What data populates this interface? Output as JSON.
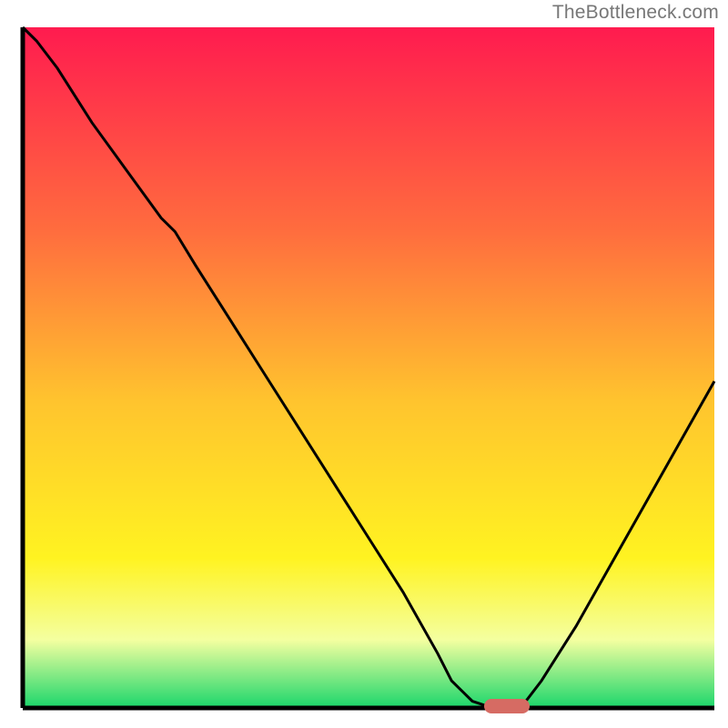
{
  "watermark": "TheBottleneck.com",
  "colors": {
    "gradient_top": "#ff1b4f",
    "gradient_mid_upper": "#ff6d3e",
    "gradient_mid": "#ffc42e",
    "gradient_mid_lower": "#fff321",
    "gradient_low": "#f4ffa0",
    "gradient_bottom": "#1ad66b",
    "curve": "#000000",
    "marker": "#d66b63",
    "axis": "#000000"
  },
  "chart_data": {
    "type": "line",
    "title": "",
    "xlabel": "",
    "ylabel": "",
    "xlim": [
      0,
      100
    ],
    "ylim": [
      0,
      100
    ],
    "marker_x": 70,
    "x": [
      0,
      2,
      5,
      10,
      15,
      20,
      22,
      25,
      30,
      35,
      40,
      45,
      50,
      55,
      60,
      62,
      65,
      68,
      70,
      72,
      75,
      80,
      85,
      90,
      95,
      100
    ],
    "values": [
      100,
      98,
      94,
      86,
      79,
      72,
      70,
      65,
      57,
      49,
      41,
      33,
      25,
      17,
      8,
      4,
      1,
      0,
      0,
      0,
      4,
      12,
      21,
      30,
      39,
      48
    ]
  }
}
